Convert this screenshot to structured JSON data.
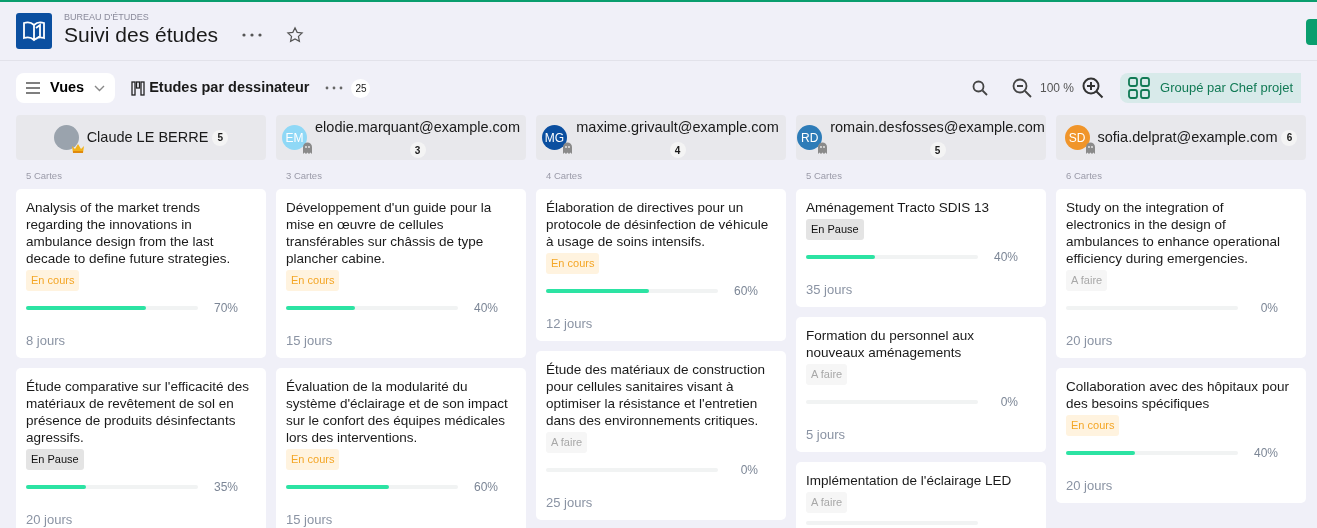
{
  "header": {
    "subtitle": "BUREAU D'ÉTUDES",
    "title": "Suivi des études",
    "favorite": false
  },
  "toolbar": {
    "views_label": "Vues",
    "view_name": "Etudes par dessinateur",
    "count": "25",
    "zoom": "100 %",
    "group_label": "Groupé par Chef projet"
  },
  "columns": [
    {
      "name": "Claude LE BERRE",
      "avatar": {
        "kind": "photo"
      },
      "count": "5",
      "cards_label": "5 Cartes",
      "cards": [
        {
          "title": "Analysis of the market trends regarding the innovations in ambulance design from the last decade to define future strategies.",
          "status": {
            "kind": "en_cours",
            "label": "En cours"
          },
          "level": 0.7,
          "percent": "70%",
          "duration": "8 jours"
        },
        {
          "title": "Étude comparative sur l'efficacité des matériaux de revêtement de sol en présence de produits désinfectants agressifs.",
          "status": {
            "kind": "en_pause",
            "label": "En Pause"
          },
          "level": 0.35,
          "percent": "35%",
          "duration": "20 jours"
        }
      ]
    },
    {
      "name": "elodie.marquant@example.com",
      "avatar": {
        "kind": "initials",
        "initials": "EM",
        "color": "#8fd8f6"
      },
      "count": "3",
      "cards_label": "3 Cartes",
      "cards": [
        {
          "title": "Développement d'un guide pour la mise en œuvre de cellules transférables sur châssis de type plancher cabine.",
          "status": {
            "kind": "en_cours",
            "label": "En cours"
          },
          "level": 0.4,
          "percent": "40%",
          "duration": "15 jours"
        },
        {
          "title": "Évaluation de la modularité du système d'éclairage et de son impact sur le confort des équipes médicales lors des interventions.",
          "status": {
            "kind": "en_cours",
            "label": "En cours"
          },
          "level": 0.6,
          "percent": "60%",
          "duration": "15 jours"
        }
      ]
    },
    {
      "name": "maxime.grivault@example.com",
      "avatar": {
        "kind": "initials",
        "initials": "MG",
        "color": "#0b4fa0"
      },
      "count": "4",
      "cards_label": "4 Cartes",
      "cards": [
        {
          "title": "Élaboration de directives pour un protocole de désinfection de véhicule à usage de soins intensifs.",
          "status": {
            "kind": "en_cours",
            "label": "En cours"
          },
          "level": 0.6,
          "percent": "60%",
          "duration": "12 jours"
        },
        {
          "title": "Étude des matériaux de construction pour cellules sanitaires visant à optimiser la résistance et l'entretien dans des environnements critiques.",
          "status": {
            "kind": "a_faire",
            "label": "A faire"
          },
          "level": 0,
          "percent": "0%",
          "duration": "25 jours"
        }
      ]
    },
    {
      "name": "romain.desfosses@example.com",
      "avatar": {
        "kind": "initials",
        "initials": "RD",
        "color": "#2e7cb8"
      },
      "count": "5",
      "cards_label": "5 Cartes",
      "cards": [
        {
          "title": "Aménagement Tracto SDIS 13",
          "status": {
            "kind": "en_pause",
            "label": "En Pause"
          },
          "level": 0.4,
          "percent": "40%",
          "duration": "35 jours"
        },
        {
          "title": "Formation du personnel aux nouveaux aménagements",
          "status": {
            "kind": "a_faire",
            "label": "A faire"
          },
          "level": 0,
          "percent": "0%",
          "duration": "5 jours"
        },
        {
          "title": "Implémentation de l'éclairage LED",
          "status": {
            "kind": "a_faire",
            "label": "A faire"
          },
          "level": 0
        }
      ]
    },
    {
      "name": "sofia.delprat@example.com",
      "avatar": {
        "kind": "initials",
        "initials": "SD",
        "color": "#f0952a"
      },
      "count": "6",
      "cards_label": "6 Cartes",
      "cards": [
        {
          "title": "Study on the integration of electronics in the design of ambulances to enhance operational efficiency during emergencies.",
          "status": {
            "kind": "a_faire",
            "label": "A faire"
          },
          "level": 0,
          "percent": "0%",
          "duration": "20 jours"
        },
        {
          "title": "Collaboration avec des hôpitaux pour des besoins spécifiques",
          "status": {
            "kind": "en_cours",
            "label": "En cours"
          },
          "level": 0.4,
          "percent": "40%",
          "duration": "20 jours"
        }
      ]
    }
  ]
}
